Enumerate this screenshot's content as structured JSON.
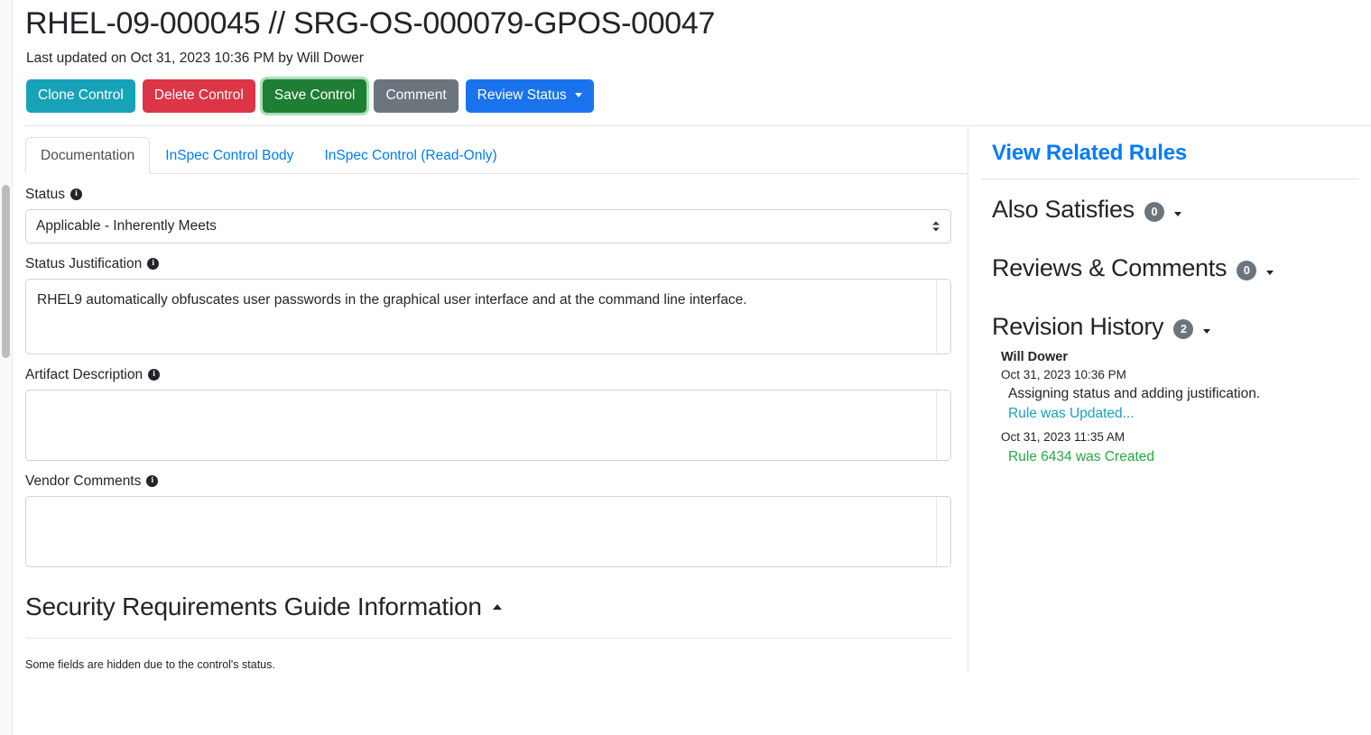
{
  "header": {
    "title": "RHEL-09-000045 // SRG-OS-000079-GPOS-00047",
    "subtitle": "Last updated on Oct 31, 2023 10:36 PM by Will Dower",
    "buttons": [
      {
        "label": "Clone Control",
        "name": "clone-control-button",
        "color": "#17a2b8"
      },
      {
        "label": "Delete Control",
        "name": "delete-control-button",
        "color": "#dc3545"
      },
      {
        "label": "Save Control",
        "name": "save-control-button",
        "color": "#1e7e34"
      },
      {
        "label": "Comment",
        "name": "comment-button",
        "color": "#6c757d"
      },
      {
        "label": "Review Status",
        "name": "review-status-button",
        "color": "#1a73ed"
      }
    ]
  },
  "tabs": [
    {
      "label": "Documentation",
      "active": true
    },
    {
      "label": "InSpec Control Body",
      "active": false
    },
    {
      "label": "InSpec Control (Read-Only)",
      "active": false
    }
  ],
  "form": {
    "status": {
      "label": "Status",
      "value": "Applicable - Inherently Meets",
      "info": "i"
    },
    "status_justification": {
      "label": "Status Justification",
      "value": "RHEL9 automatically obfuscates user passwords in the graphical user interface and at the command line interface.",
      "placeholder": "",
      "info": "i"
    },
    "artifact_description": {
      "label": "Artifact Description",
      "value": "",
      "placeholder": "",
      "info": "i"
    },
    "vendor_comments": {
      "label": "Vendor Comments",
      "value": "",
      "placeholder": "",
      "info": "i"
    }
  },
  "section": {
    "title": "Security Requirements Guide Information",
    "collapse_icon": "caret-up-icon",
    "hidden_note": "Some fields are hidden due to the control's status."
  },
  "sidebar": {
    "related_rules_link": "View Related Rules",
    "also_satisfies": {
      "title": "Also Satisfies",
      "count": "0"
    },
    "reviews_comments": {
      "title": "Reviews & Comments",
      "count": "0"
    },
    "revision_history": {
      "title": "Revision History",
      "count": "2",
      "entries": [
        {
          "author": "Will Dower",
          "date": "Oct 31, 2023 10:36 PM",
          "message": "Assigning status and adding justification.",
          "action": "Rule was Updated...",
          "action_color": "#17a2b8"
        },
        {
          "author": "",
          "date": "Oct 31, 2023 11:35 AM",
          "message": "",
          "action": "Rule 6434 was Created",
          "action_color": "#28a745"
        }
      ]
    }
  },
  "annotation": {
    "color": "#fb1108",
    "target": "revision-history-panel"
  }
}
